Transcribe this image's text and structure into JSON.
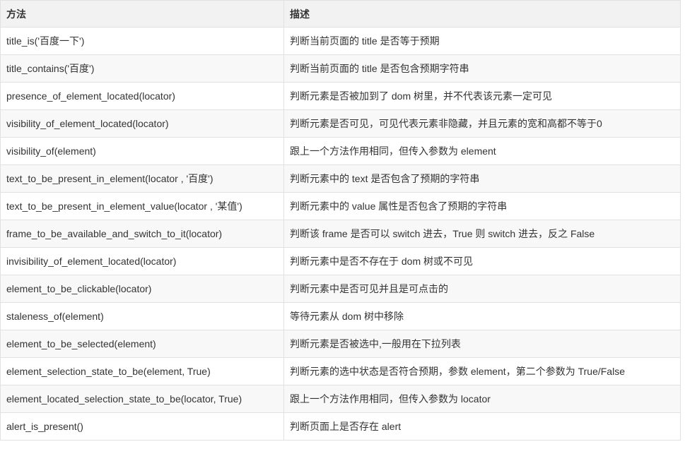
{
  "table": {
    "headers": [
      "方法",
      "描述"
    ],
    "rows": [
      [
        "title_is('百度一下')",
        "判断当前页面的 title 是否等于预期"
      ],
      [
        "title_contains('百度')",
        "判断当前页面的 title 是否包含预期字符串"
      ],
      [
        "presence_of_element_located(locator)",
        "判断元素是否被加到了 dom 树里，并不代表该元素一定可见"
      ],
      [
        "visibility_of_element_located(locator)",
        "判断元素是否可见，可见代表元素非隐藏，并且元素的宽和高都不等于0"
      ],
      [
        "visibility_of(element)",
        "跟上一个方法作用相同，但传入参数为 element"
      ],
      [
        "text_to_be_present_in_element(locator , '百度')",
        "判断元素中的 text 是否包含了预期的字符串"
      ],
      [
        "text_to_be_present_in_element_value(locator , '某值')",
        "判断元素中的 value 属性是否包含了预期的字符串"
      ],
      [
        "frame_to_be_available_and_switch_to_it(locator)",
        "判断该 frame 是否可以 switch 进去，True 则 switch 进去，反之 False"
      ],
      [
        "invisibility_of_element_located(locator)",
        "判断元素中是否不存在于 dom 树或不可见"
      ],
      [
        "element_to_be_clickable(locator)",
        "判断元素中是否可见并且是可点击的"
      ],
      [
        "staleness_of(element)",
        "等待元素从 dom 树中移除"
      ],
      [
        "element_to_be_selected(element)",
        "判断元素是否被选中,一般用在下拉列表"
      ],
      [
        "element_selection_state_to_be(element, True)",
        "判断元素的选中状态是否符合预期，参数 element，第二个参数为 True/False"
      ],
      [
        "element_located_selection_state_to_be(locator, True)",
        "跟上一个方法作用相同，但传入参数为 locator"
      ],
      [
        "alert_is_present()",
        "判断页面上是否存在 alert"
      ]
    ]
  }
}
